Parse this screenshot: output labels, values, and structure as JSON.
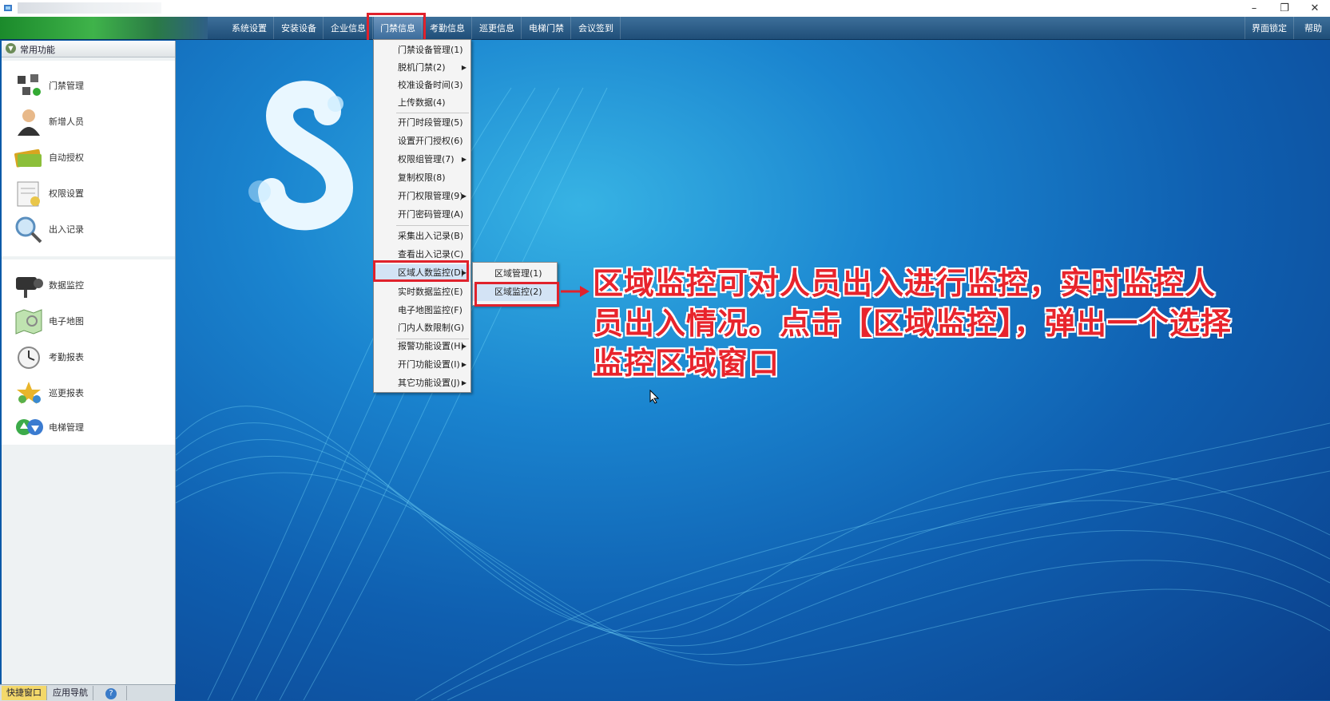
{
  "window": {
    "minimize": "–",
    "restore": "❐",
    "close": "✕"
  },
  "menubar": {
    "items": [
      {
        "label": "系统设置"
      },
      {
        "label": "安装设备"
      },
      {
        "label": "企业信息"
      },
      {
        "label": "门禁信息"
      },
      {
        "label": "考勤信息"
      },
      {
        "label": "巡更信息"
      },
      {
        "label": "电梯门禁"
      },
      {
        "label": "会议签到"
      }
    ],
    "right_items": [
      {
        "label": "界面锁定"
      },
      {
        "label": "帮助"
      }
    ]
  },
  "left_panel": {
    "header": "常用功能",
    "group1": [
      {
        "label": "门禁管理",
        "icon": "door-access-icon"
      },
      {
        "label": "新增人员",
        "icon": "person-icon"
      },
      {
        "label": "自动授权",
        "icon": "card-icon"
      },
      {
        "label": "权限设置",
        "icon": "permission-icon"
      },
      {
        "label": "出入记录",
        "icon": "magnifier-icon"
      }
    ],
    "group2": [
      {
        "label": "数据监控",
        "icon": "camera-icon"
      },
      {
        "label": "电子地图",
        "icon": "map-icon"
      },
      {
        "label": "考勤报表",
        "icon": "clock-icon"
      },
      {
        "label": "巡更报表",
        "icon": "patrol-icon"
      },
      {
        "label": "电梯管理",
        "icon": "elevator-icon"
      }
    ],
    "bottom_tabs": [
      {
        "label": "快捷窗口"
      },
      {
        "label": "应用导航"
      },
      {
        "label": "?"
      }
    ]
  },
  "dropdown": {
    "items": [
      {
        "label": "门禁设备管理(1)",
        "has_sub": false
      },
      {
        "label": "脱机门禁(2)",
        "has_sub": true
      },
      {
        "label": "校准设备时间(3)",
        "has_sub": false
      },
      {
        "label": "上传数据(4)",
        "has_sub": false
      },
      {
        "label": "开门时段管理(5)",
        "has_sub": false
      },
      {
        "label": "设置开门授权(6)",
        "has_sub": false
      },
      {
        "label": "权限组管理(7)",
        "has_sub": true
      },
      {
        "label": "复制权限(8)",
        "has_sub": false
      },
      {
        "label": "开门权限管理(9)",
        "has_sub": true
      },
      {
        "label": "开门密码管理(A)",
        "has_sub": false
      },
      {
        "label": "采集出入记录(B)",
        "has_sub": false
      },
      {
        "label": "查看出入记录(C)",
        "has_sub": false
      },
      {
        "label": "区域人数监控(D)",
        "has_sub": true
      },
      {
        "label": "实时数据监控(E)",
        "has_sub": false
      },
      {
        "label": "电子地图监控(F)",
        "has_sub": false
      },
      {
        "label": "门内人数限制(G)",
        "has_sub": false
      },
      {
        "label": "报警功能设置(H)",
        "has_sub": true
      },
      {
        "label": "开门功能设置(I)",
        "has_sub": true
      },
      {
        "label": "其它功能设置(J)",
        "has_sub": true
      }
    ]
  },
  "submenu": {
    "items": [
      {
        "label": "区域管理(1)"
      },
      {
        "label": "区域监控(2)"
      }
    ]
  },
  "annotation": {
    "text": "区域监控可对人员出入进行监控，实时监控人员出入情况。点击【区域监控】，弹出一个选择监控区域窗口"
  },
  "colors": {
    "highlight": "#e0222c",
    "annotation_text": "#e8242c",
    "quick_tab": "#f3d86a"
  }
}
